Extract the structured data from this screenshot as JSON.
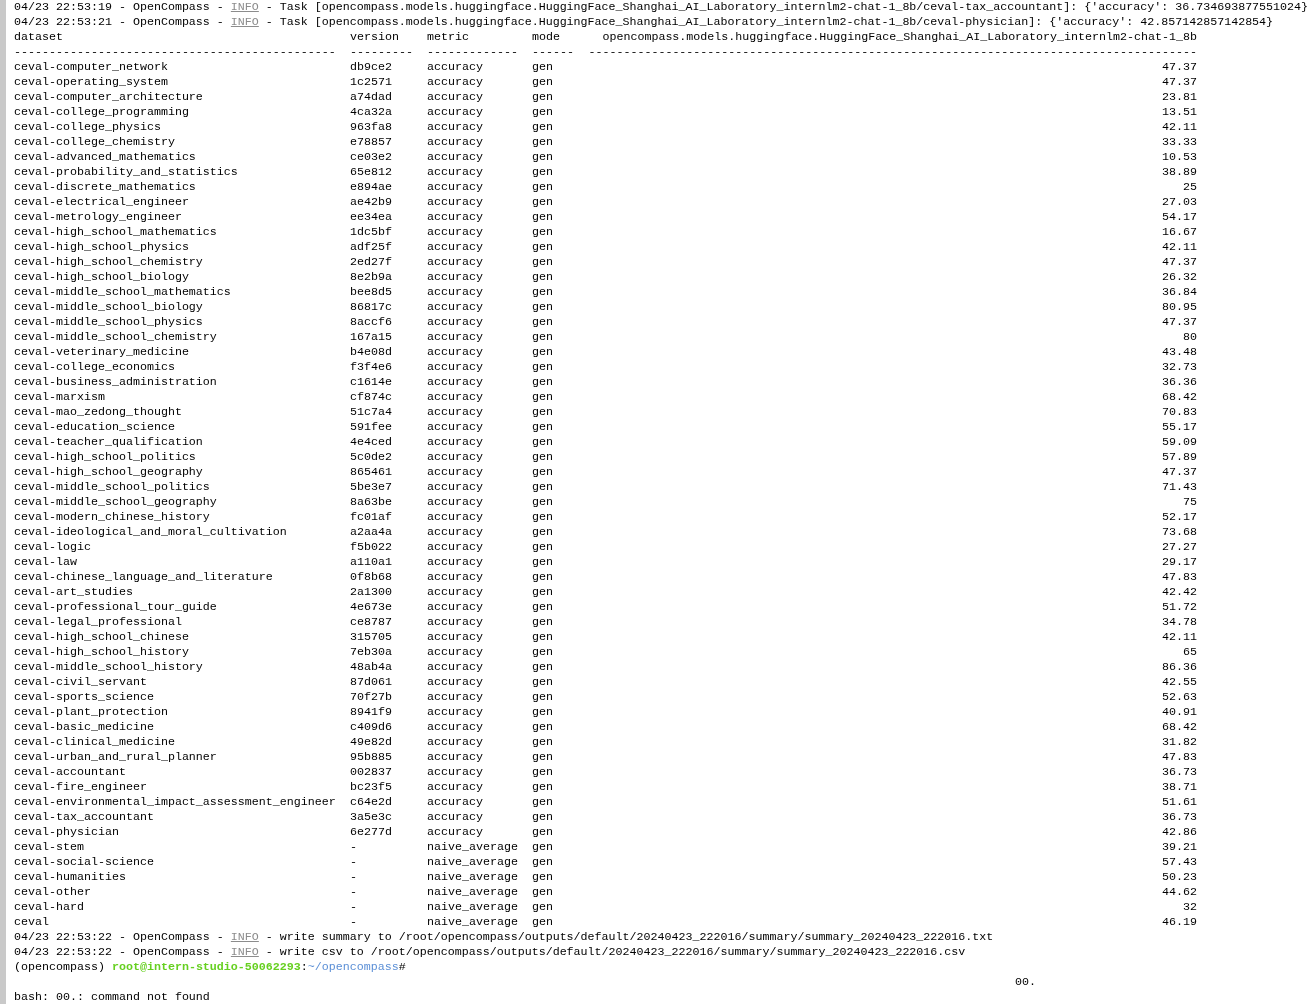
{
  "log_top": [
    {
      "prefix": "04/23 22:53:19 - OpenCompass -",
      "level": "INFO",
      "message": "- Task [opencompass.models.huggingface.HuggingFace_Shanghai_AI_Laboratory_internlm2-chat-1_8b/ceval-tax_accountant]: {'accuracy': 36.734693877551024}"
    },
    {
      "prefix": "04/23 22:53:21 - OpenCompass -",
      "level": "INFO",
      "message": "- Task [opencompass.models.huggingface.HuggingFace_Shanghai_AI_Laboratory_internlm2-chat-1_8b/ceval-physician]: {'accuracy': 42.857142857142854}"
    }
  ],
  "table": {
    "columns": [
      "dataset",
      "version",
      "metric",
      "mode",
      "opencompass.models.huggingface.HuggingFace_Shanghai_AI_Laboratory_internlm2-chat-1_8b"
    ],
    "rules": [
      "----------------------------------------------",
      "---------",
      "-------------",
      "------",
      "---------------------------------------------------------------------------------------"
    ],
    "rows": [
      {
        "dataset": "ceval-computer_network",
        "version": "db9ce2",
        "metric": "accuracy",
        "mode": "gen",
        "score": "47.37"
      },
      {
        "dataset": "ceval-operating_system",
        "version": "1c2571",
        "metric": "accuracy",
        "mode": "gen",
        "score": "47.37"
      },
      {
        "dataset": "ceval-computer_architecture",
        "version": "a74dad",
        "metric": "accuracy",
        "mode": "gen",
        "score": "23.81"
      },
      {
        "dataset": "ceval-college_programming",
        "version": "4ca32a",
        "metric": "accuracy",
        "mode": "gen",
        "score": "13.51"
      },
      {
        "dataset": "ceval-college_physics",
        "version": "963fa8",
        "metric": "accuracy",
        "mode": "gen",
        "score": "42.11"
      },
      {
        "dataset": "ceval-college_chemistry",
        "version": "e78857",
        "metric": "accuracy",
        "mode": "gen",
        "score": "33.33"
      },
      {
        "dataset": "ceval-advanced_mathematics",
        "version": "ce03e2",
        "metric": "accuracy",
        "mode": "gen",
        "score": "10.53"
      },
      {
        "dataset": "ceval-probability_and_statistics",
        "version": "65e812",
        "metric": "accuracy",
        "mode": "gen",
        "score": "38.89"
      },
      {
        "dataset": "ceval-discrete_mathematics",
        "version": "e894ae",
        "metric": "accuracy",
        "mode": "gen",
        "score": "25"
      },
      {
        "dataset": "ceval-electrical_engineer",
        "version": "ae42b9",
        "metric": "accuracy",
        "mode": "gen",
        "score": "27.03"
      },
      {
        "dataset": "ceval-metrology_engineer",
        "version": "ee34ea",
        "metric": "accuracy",
        "mode": "gen",
        "score": "54.17"
      },
      {
        "dataset": "ceval-high_school_mathematics",
        "version": "1dc5bf",
        "metric": "accuracy",
        "mode": "gen",
        "score": "16.67"
      },
      {
        "dataset": "ceval-high_school_physics",
        "version": "adf25f",
        "metric": "accuracy",
        "mode": "gen",
        "score": "42.11"
      },
      {
        "dataset": "ceval-high_school_chemistry",
        "version": "2ed27f",
        "metric": "accuracy",
        "mode": "gen",
        "score": "47.37"
      },
      {
        "dataset": "ceval-high_school_biology",
        "version": "8e2b9a",
        "metric": "accuracy",
        "mode": "gen",
        "score": "26.32"
      },
      {
        "dataset": "ceval-middle_school_mathematics",
        "version": "bee8d5",
        "metric": "accuracy",
        "mode": "gen",
        "score": "36.84"
      },
      {
        "dataset": "ceval-middle_school_biology",
        "version": "86817c",
        "metric": "accuracy",
        "mode": "gen",
        "score": "80.95"
      },
      {
        "dataset": "ceval-middle_school_physics",
        "version": "8accf6",
        "metric": "accuracy",
        "mode": "gen",
        "score": "47.37"
      },
      {
        "dataset": "ceval-middle_school_chemistry",
        "version": "167a15",
        "metric": "accuracy",
        "mode": "gen",
        "score": "80"
      },
      {
        "dataset": "ceval-veterinary_medicine",
        "version": "b4e08d",
        "metric": "accuracy",
        "mode": "gen",
        "score": "43.48"
      },
      {
        "dataset": "ceval-college_economics",
        "version": "f3f4e6",
        "metric": "accuracy",
        "mode": "gen",
        "score": "32.73"
      },
      {
        "dataset": "ceval-business_administration",
        "version": "c1614e",
        "metric": "accuracy",
        "mode": "gen",
        "score": "36.36"
      },
      {
        "dataset": "ceval-marxism",
        "version": "cf874c",
        "metric": "accuracy",
        "mode": "gen",
        "score": "68.42"
      },
      {
        "dataset": "ceval-mao_zedong_thought",
        "version": "51c7a4",
        "metric": "accuracy",
        "mode": "gen",
        "score": "70.83"
      },
      {
        "dataset": "ceval-education_science",
        "version": "591fee",
        "metric": "accuracy",
        "mode": "gen",
        "score": "55.17"
      },
      {
        "dataset": "ceval-teacher_qualification",
        "version": "4e4ced",
        "metric": "accuracy",
        "mode": "gen",
        "score": "59.09"
      },
      {
        "dataset": "ceval-high_school_politics",
        "version": "5c0de2",
        "metric": "accuracy",
        "mode": "gen",
        "score": "57.89"
      },
      {
        "dataset": "ceval-high_school_geography",
        "version": "865461",
        "metric": "accuracy",
        "mode": "gen",
        "score": "47.37"
      },
      {
        "dataset": "ceval-middle_school_politics",
        "version": "5be3e7",
        "metric": "accuracy",
        "mode": "gen",
        "score": "71.43"
      },
      {
        "dataset": "ceval-middle_school_geography",
        "version": "8a63be",
        "metric": "accuracy",
        "mode": "gen",
        "score": "75"
      },
      {
        "dataset": "ceval-modern_chinese_history",
        "version": "fc01af",
        "metric": "accuracy",
        "mode": "gen",
        "score": "52.17"
      },
      {
        "dataset": "ceval-ideological_and_moral_cultivation",
        "version": "a2aa4a",
        "metric": "accuracy",
        "mode": "gen",
        "score": "73.68"
      },
      {
        "dataset": "ceval-logic",
        "version": "f5b022",
        "metric": "accuracy",
        "mode": "gen",
        "score": "27.27"
      },
      {
        "dataset": "ceval-law",
        "version": "a110a1",
        "metric": "accuracy",
        "mode": "gen",
        "score": "29.17"
      },
      {
        "dataset": "ceval-chinese_language_and_literature",
        "version": "0f8b68",
        "metric": "accuracy",
        "mode": "gen",
        "score": "47.83"
      },
      {
        "dataset": "ceval-art_studies",
        "version": "2a1300",
        "metric": "accuracy",
        "mode": "gen",
        "score": "42.42"
      },
      {
        "dataset": "ceval-professional_tour_guide",
        "version": "4e673e",
        "metric": "accuracy",
        "mode": "gen",
        "score": "51.72"
      },
      {
        "dataset": "ceval-legal_professional",
        "version": "ce8787",
        "metric": "accuracy",
        "mode": "gen",
        "score": "34.78"
      },
      {
        "dataset": "ceval-high_school_chinese",
        "version": "315705",
        "metric": "accuracy",
        "mode": "gen",
        "score": "42.11"
      },
      {
        "dataset": "ceval-high_school_history",
        "version": "7eb30a",
        "metric": "accuracy",
        "mode": "gen",
        "score": "65"
      },
      {
        "dataset": "ceval-middle_school_history",
        "version": "48ab4a",
        "metric": "accuracy",
        "mode": "gen",
        "score": "86.36"
      },
      {
        "dataset": "ceval-civil_servant",
        "version": "87d061",
        "metric": "accuracy",
        "mode": "gen",
        "score": "42.55"
      },
      {
        "dataset": "ceval-sports_science",
        "version": "70f27b",
        "metric": "accuracy",
        "mode": "gen",
        "score": "52.63"
      },
      {
        "dataset": "ceval-plant_protection",
        "version": "8941f9",
        "metric": "accuracy",
        "mode": "gen",
        "score": "40.91"
      },
      {
        "dataset": "ceval-basic_medicine",
        "version": "c409d6",
        "metric": "accuracy",
        "mode": "gen",
        "score": "68.42"
      },
      {
        "dataset": "ceval-clinical_medicine",
        "version": "49e82d",
        "metric": "accuracy",
        "mode": "gen",
        "score": "31.82"
      },
      {
        "dataset": "ceval-urban_and_rural_planner",
        "version": "95b885",
        "metric": "accuracy",
        "mode": "gen",
        "score": "47.83"
      },
      {
        "dataset": "ceval-accountant",
        "version": "002837",
        "metric": "accuracy",
        "mode": "gen",
        "score": "36.73"
      },
      {
        "dataset": "ceval-fire_engineer",
        "version": "bc23f5",
        "metric": "accuracy",
        "mode": "gen",
        "score": "38.71"
      },
      {
        "dataset": "ceval-environmental_impact_assessment_engineer",
        "version": "c64e2d",
        "metric": "accuracy",
        "mode": "gen",
        "score": "51.61"
      },
      {
        "dataset": "ceval-tax_accountant",
        "version": "3a5e3c",
        "metric": "accuracy",
        "mode": "gen",
        "score": "36.73"
      },
      {
        "dataset": "ceval-physician",
        "version": "6e277d",
        "metric": "accuracy",
        "mode": "gen",
        "score": "42.86"
      },
      {
        "dataset": "ceval-stem",
        "version": "-",
        "metric": "naive_average",
        "mode": "gen",
        "score": "39.21"
      },
      {
        "dataset": "ceval-social-science",
        "version": "-",
        "metric": "naive_average",
        "mode": "gen",
        "score": "57.43"
      },
      {
        "dataset": "ceval-humanities",
        "version": "-",
        "metric": "naive_average",
        "mode": "gen",
        "score": "50.23"
      },
      {
        "dataset": "ceval-other",
        "version": "-",
        "metric": "naive_average",
        "mode": "gen",
        "score": "44.62"
      },
      {
        "dataset": "ceval-hard",
        "version": "-",
        "metric": "naive_average",
        "mode": "gen",
        "score": "32"
      },
      {
        "dataset": "ceval",
        "version": "-",
        "metric": "naive_average",
        "mode": "gen",
        "score": "46.19"
      }
    ]
  },
  "log_bottom": [
    {
      "prefix": "04/23 22:53:22 - OpenCompass -",
      "level": "INFO",
      "message": "- write summary to /root/opencompass/outputs/default/20240423_222016/summary/summary_20240423_222016.txt"
    },
    {
      "prefix": "04/23 22:53:22 - OpenCompass -",
      "level": "INFO",
      "message": "- write csv to /root/opencompass/outputs/default/20240423_222016/summary/summary_20240423_222016.csv"
    }
  ],
  "prompt": {
    "env": "(opencompass)",
    "user": "root@intern-studio-50062293",
    "colon": ":",
    "path": "~/opencompass",
    "symbol": "#"
  },
  "typed_input": "00.",
  "error_line": "bash: 00.: command not found"
}
